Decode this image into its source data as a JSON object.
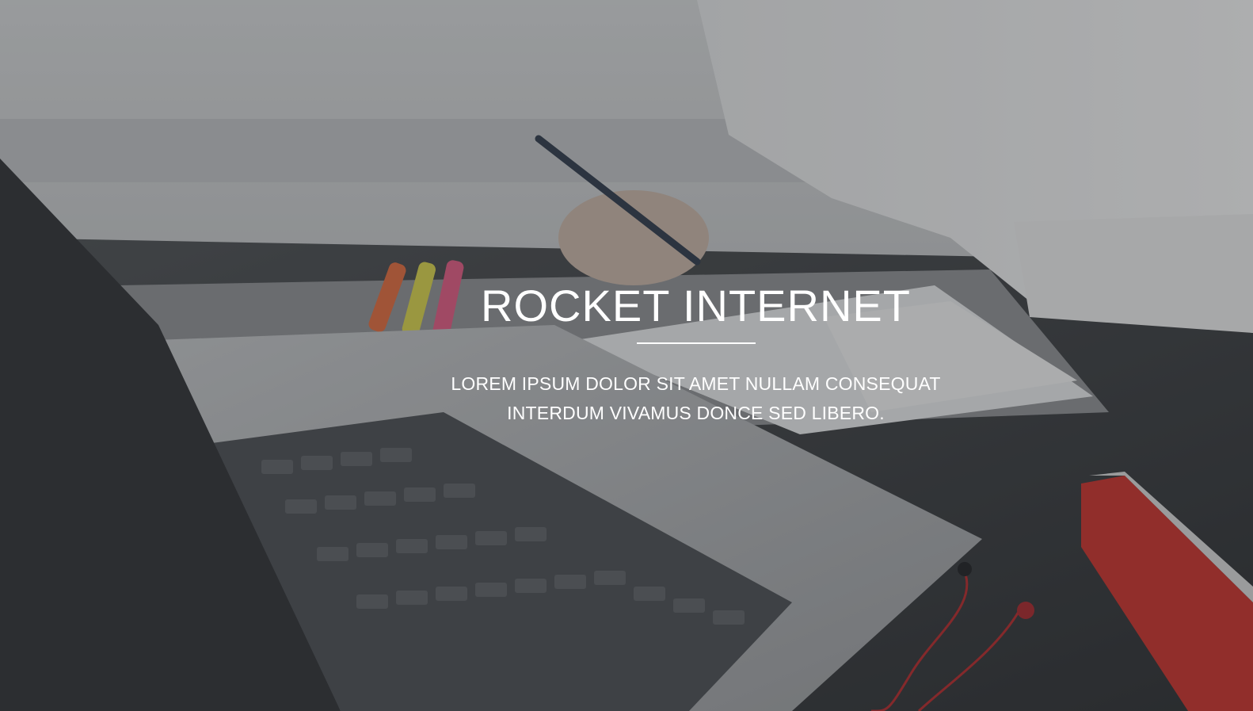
{
  "hero": {
    "title": "ROCKET INTERNET",
    "subtitle": "LOREM IPSUM DOLOR SIT AMET NULLAM CONSEQUAT INTERDUM VIVAMUS DONCE SED LIBERO.",
    "background_image": "laptop-desk-workspace-photo",
    "overlay_color": "#2a2c30"
  }
}
